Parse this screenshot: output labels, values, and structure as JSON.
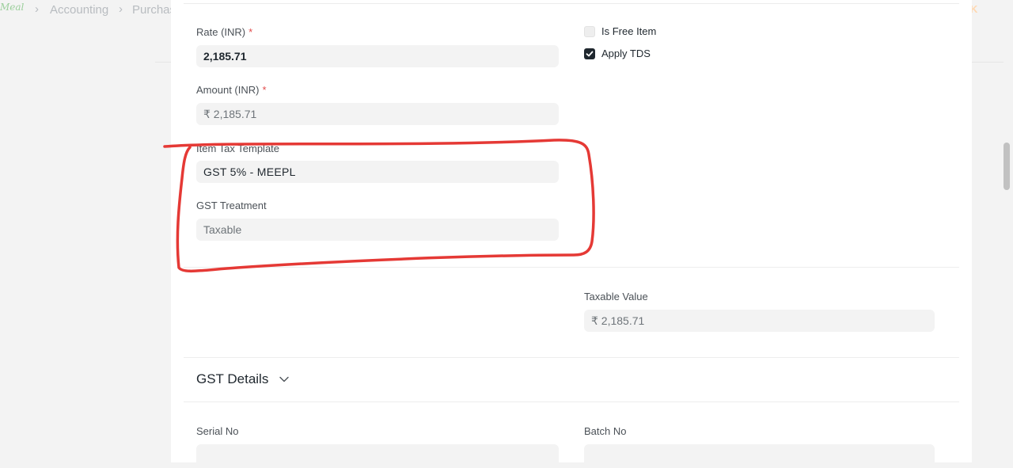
{
  "breadcrumb": {
    "logo_text": "Meal",
    "items": [
      "Accounting",
      "Purchas"
    ],
    "right_fragment": "K"
  },
  "form": {
    "rate": {
      "label": "Rate (INR)",
      "required_mark": "*",
      "value": "2,185.71"
    },
    "amount": {
      "label": "Amount (INR)",
      "required_mark": "*",
      "value": "₹ 2,185.71"
    },
    "item_tax_template": {
      "label": "Item Tax Template",
      "value": "GST 5% - MEEPL"
    },
    "gst_treatment": {
      "label": "GST Treatment",
      "value": "Taxable"
    },
    "taxable_value": {
      "label": "Taxable Value",
      "value": "₹ 2,185.71"
    },
    "is_free_item": {
      "label": "Is Free Item",
      "checked": false
    },
    "apply_tds": {
      "label": "Apply TDS",
      "checked": true
    },
    "serial_no": {
      "label": "Serial No",
      "value": ""
    },
    "batch_no": {
      "label": "Batch No",
      "value": ""
    }
  },
  "sections": {
    "gst_details": {
      "title": "GST Details",
      "icon": "chevron-down-icon"
    }
  },
  "colors": {
    "annotation_red": "#e53935",
    "checkbox_checked": "#1f272e",
    "required_star": "#e24c4c"
  }
}
